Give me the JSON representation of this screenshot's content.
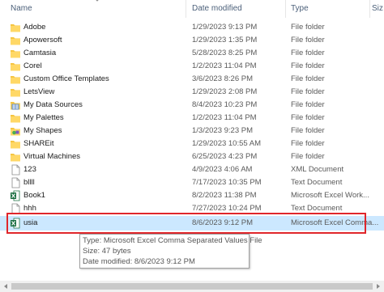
{
  "header": {
    "name": "Name",
    "date": "Date modified",
    "type": "Type",
    "size": "Siz"
  },
  "rows": [
    {
      "name": "Adobe",
      "date": "1/29/2023 9:13 PM",
      "type": "File folder",
      "icon": "folder-icon"
    },
    {
      "name": "Apowersoft",
      "date": "1/29/2023 1:35 PM",
      "type": "File folder",
      "icon": "folder-icon"
    },
    {
      "name": "Camtasia",
      "date": "5/28/2023 8:25 PM",
      "type": "File folder",
      "icon": "folder-icon"
    },
    {
      "name": "Corel",
      "date": "1/2/2023 11:04 PM",
      "type": "File folder",
      "icon": "folder-icon"
    },
    {
      "name": "Custom Office Templates",
      "date": "3/6/2023 8:26 PM",
      "type": "File folder",
      "icon": "folder-icon"
    },
    {
      "name": "LetsView",
      "date": "1/29/2023 2:08 PM",
      "type": "File folder",
      "icon": "folder-icon"
    },
    {
      "name": "My Data Sources",
      "date": "8/4/2023 10:23 PM",
      "type": "File folder",
      "icon": "data-sources-folder-icon"
    },
    {
      "name": "My Palettes",
      "date": "1/2/2023 11:04 PM",
      "type": "File folder",
      "icon": "folder-icon"
    },
    {
      "name": "My Shapes",
      "date": "1/3/2023 9:23 PM",
      "type": "File folder",
      "icon": "shapes-folder-icon"
    },
    {
      "name": "SHAREit",
      "date": "1/29/2023 10:55 AM",
      "type": "File folder",
      "icon": "folder-icon"
    },
    {
      "name": "Virtual Machines",
      "date": "6/25/2023 4:23 PM",
      "type": "File folder",
      "icon": "folder-icon"
    },
    {
      "name": "123",
      "date": "4/9/2023 4:06 AM",
      "type": "XML Document",
      "icon": "document-icon"
    },
    {
      "name": "bllll",
      "date": "7/17/2023 10:35 PM",
      "type": "Text Document",
      "icon": "document-icon"
    },
    {
      "name": "Book1",
      "date": "8/2/2023 11:38 PM",
      "type": "Microsoft Excel Work...",
      "icon": "excel-icon"
    },
    {
      "name": "hhh",
      "date": "7/27/2023 10:24 PM",
      "type": "Text Document",
      "icon": "document-icon"
    },
    {
      "name": "usia",
      "date": "8/6/2023 9:12 PM",
      "type": "Microsoft Excel Comma...",
      "icon": "excel-csv-icon"
    }
  ],
  "tooltip": {
    "type_line": "Type: Microsoft Excel Comma Separated Values File",
    "size_line": "Size: 47 bytes",
    "date_line": "Date modified: 8/6/2023 9:12 PM"
  },
  "colors": {
    "folder": "#f5c542",
    "excel": "#1d7044",
    "highlight": "#e0262b",
    "selected": "#cce8ff"
  },
  "selected_row": 15
}
